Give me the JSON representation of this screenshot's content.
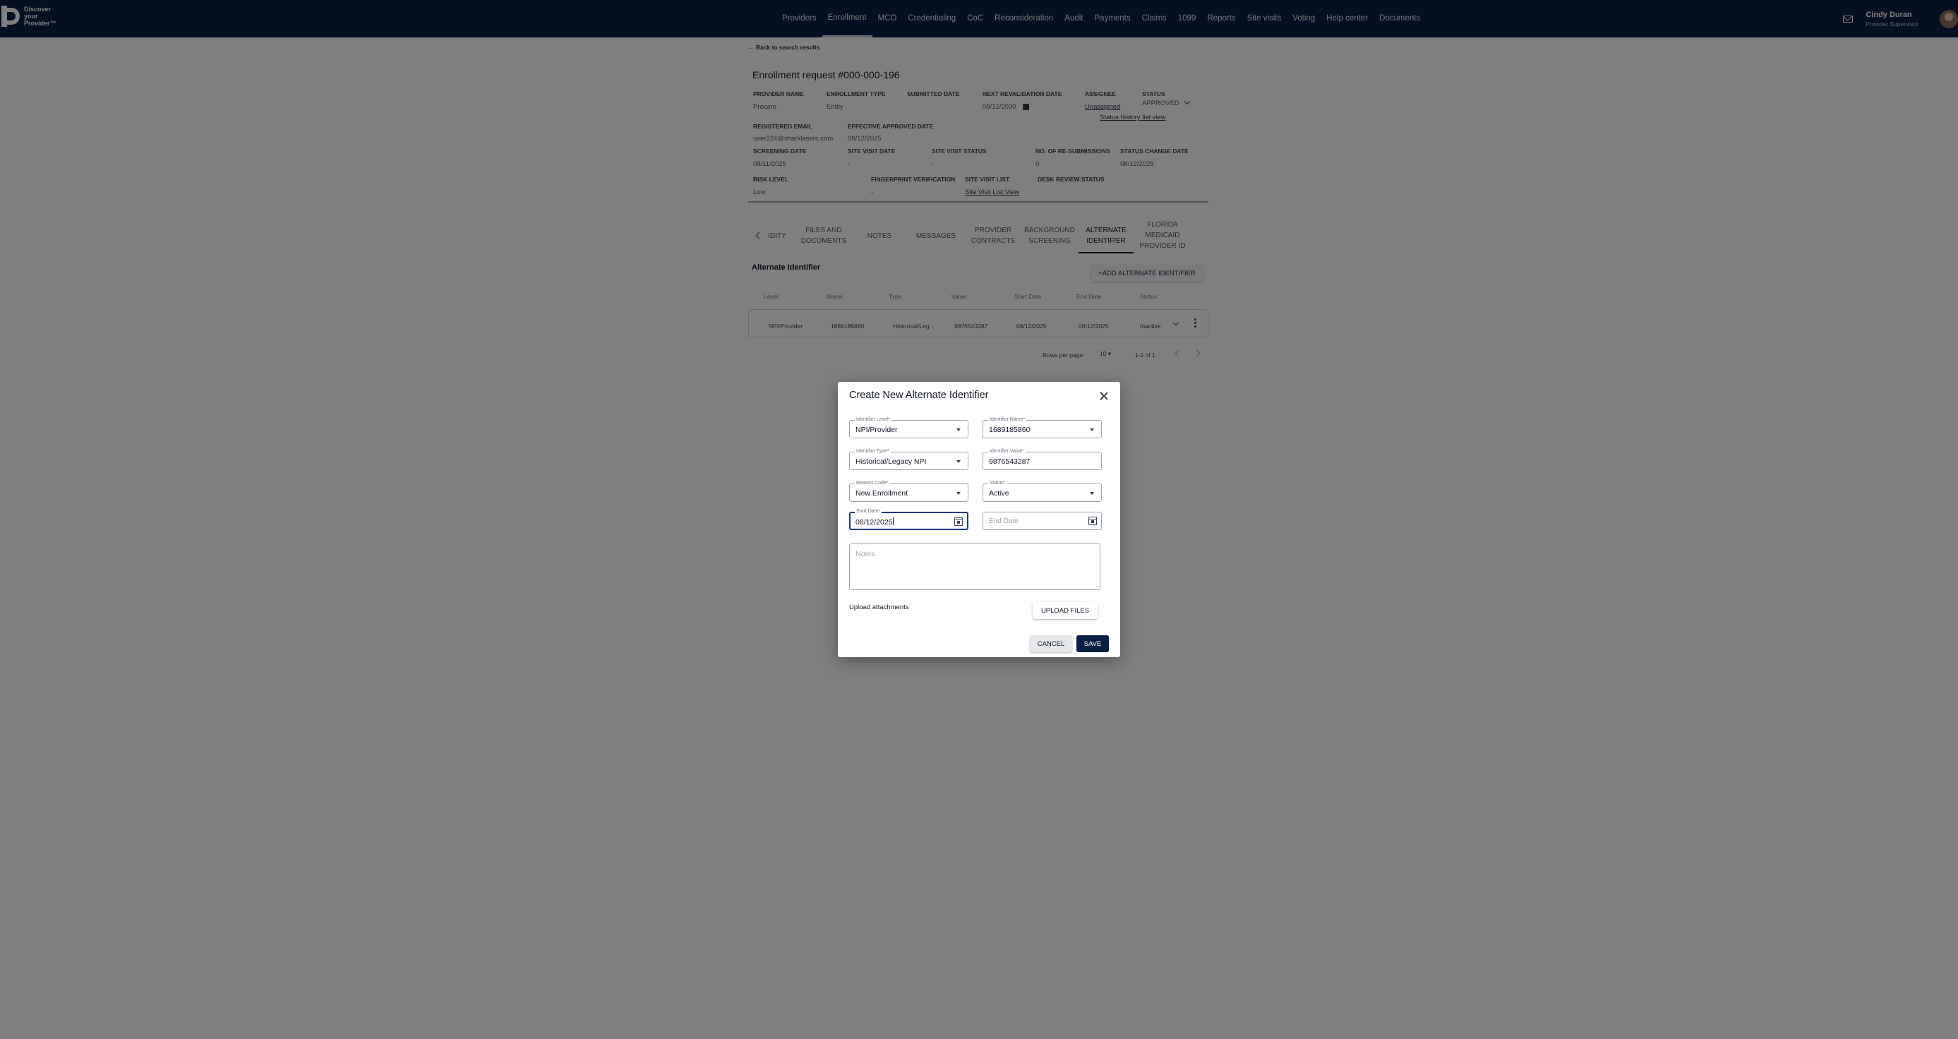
{
  "brand": {
    "logo_text": [
      "Discover",
      "your",
      "Provider™"
    ]
  },
  "nav": {
    "items": [
      "Providers",
      "Enrollment",
      "MCO",
      "Credentialing",
      "CoC",
      "Reconsideration",
      "Audit",
      "Payments",
      "Claims",
      "1099",
      "Reports",
      "Site visits",
      "Voting",
      "Help center",
      "Documents"
    ],
    "active": "Enrollment"
  },
  "user": {
    "name": "Cindy Duran",
    "role": "Provider Supervisor"
  },
  "page": {
    "back_link": "← Back to search results",
    "title": "Enrollment request #000-000-196"
  },
  "info": {
    "provider_name_label": "PROVIDER NAME",
    "provider_name": "Procare",
    "enrollment_type_label": "ENROLLMENT TYPE",
    "enrollment_type": "Entity",
    "submitted_date_label": "SUBMITTED DATE",
    "next_revalidation_label": "NEXT REVALIDATION DATE",
    "next_revalidation": "08/12/2030",
    "assignee_label": "ASSIGNEE",
    "assignee": "Unassigned",
    "status_label": "STATUS",
    "status": "APPROVED",
    "status_history": "Status history list view",
    "registered_email_label": "REGISTERED EMAIL",
    "registered_email": "user224@sharklasers.com",
    "effective_approved_label": "EFFECTIVE APPROVED DATE",
    "effective_approved": "08/12/2025",
    "screening_date_label": "SCREENING DATE",
    "screening_date": "08/11/2025",
    "site_visit_date_label": "SITE VISIT DATE",
    "site_visit_date": "-",
    "site_visit_status_label": "SITE VISIT STATUS",
    "site_visit_status": "-",
    "resubmissions_label": "NO. OF RE-SUBMISSIONS",
    "resubmissions": "0",
    "status_change_label": "STATUS CHANGE DATE",
    "status_change": "08/12/2025",
    "risk_level_label": "RISK LEVEL",
    "risk_level": "Low",
    "fingerprint_label": "FINGERPRINT VERIFICATION",
    "fingerprint": "-",
    "site_visit_list_label": "SITE VISIT LIST",
    "site_visit_list": "Site Visit List View",
    "desk_review_label": "DESK REVIEW STATUS"
  },
  "tabs": {
    "t0": "IDITY",
    "t1a": "FILES AND",
    "t1b": "DOCUMENTS",
    "t2": "NOTES",
    "t3": "MESSAGES",
    "t4a": "PROVIDER",
    "t4b": "CONTRACTS",
    "t5a": "BACKGROUND",
    "t5b": "SCREENING",
    "t6a": "ALTERNATE",
    "t6b": "IDENTIFIER",
    "t7a": "FLORIDA",
    "t7b": "MEDICAID",
    "t7c": "PROVIDER ID"
  },
  "alt_section": {
    "title": "Alternate Identifier",
    "add_button": "+ADD ALTERNATE IDENTIFIER",
    "columns": [
      "Level",
      "Name",
      "Type",
      "Value",
      "Start Date",
      "End Date",
      "Status"
    ],
    "rows": [
      [
        "NPI/Provider",
        "1689185860",
        "Historical/Leg...",
        "9876543287",
        "08/12/2025",
        "08/12/2025",
        "Inactive"
      ]
    ],
    "rows_per_page_label": "Rows per page:",
    "rows_per_page": "10",
    "range": "1-1 of 1"
  },
  "modal": {
    "title": "Create New Alternate Identifier",
    "identifier_level_label": "Identifier Level*",
    "identifier_level": "NPI/Provider",
    "identifier_name_label": "Identifier Name*",
    "identifier_name": "1689185860",
    "identifier_type_label": "Identifier Type*",
    "identifier_type": "Historical/Legacy NPI",
    "identifier_value_label": "Identifier Value*",
    "identifier_value": "9876543287",
    "reason_code_label": "Reason Code*",
    "reason_code": "New Enrollment",
    "status_label": "Status*",
    "status": "Active",
    "start_date_label": "Start Date*",
    "start_date": "08/12/2025",
    "end_date_placeholder": "End Date",
    "notes_placeholder": "Notes",
    "upload_label": "Upload attachments",
    "upload_button": "UPLOAD FILES",
    "cancel_button": "CANCEL",
    "save_button": "SAVE"
  }
}
